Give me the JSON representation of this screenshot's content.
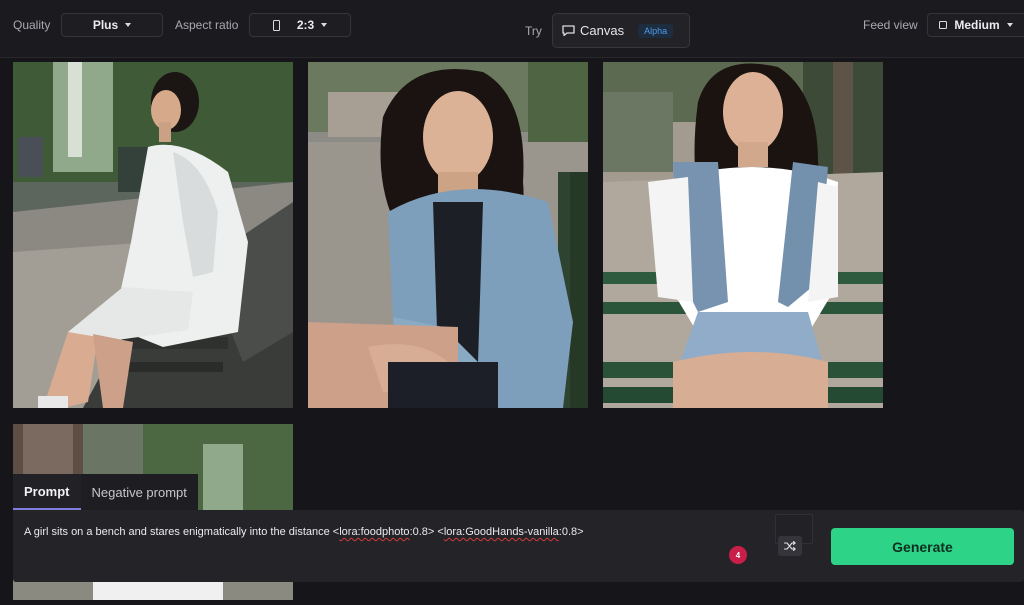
{
  "toolbar": {
    "quality_label": "Quality",
    "quality_value": "Plus",
    "aspect_label": "Aspect ratio",
    "aspect_value": "2:3",
    "try_label": "Try",
    "canvas_label": "Canvas",
    "canvas_badge": "Alpha",
    "feed_view_label": "Feed view",
    "feed_view_value": "Medium"
  },
  "icons": {
    "quality_caret": "chevron-down-icon",
    "aspect_icon": "portrait-ratio-icon",
    "canvas_icon": "chat-canvas-icon",
    "feed_icon": "square-icon",
    "shuffle": "shuffle-icon"
  },
  "images": [
    {
      "name": "generated-image-1",
      "description": "girl in white shirt sitting on bench in profile"
    },
    {
      "name": "generated-image-2",
      "description": "girl in denim jacket sitting on bench"
    },
    {
      "name": "generated-image-3",
      "description": "girl in denim vest sitting on green bench"
    },
    {
      "name": "generated-image-4",
      "description": "partially hidden image behind prompt panel"
    }
  ],
  "prompt": {
    "tab_prompt": "Prompt",
    "tab_negative": "Negative prompt",
    "text_main": "A girl sits on a bench and stares enigmatically into the distance <",
    "lora_1": "lora:foodphoto",
    "text_mid": ":0.8> <",
    "lora_2": "lora:GoodHands-vanilla",
    "text_end": ":0.8>",
    "badge_count": "4",
    "generate_label": "Generate"
  },
  "colors": {
    "accent_green": "#2dd488",
    "badge_red": "#c81e47",
    "alpha_blue": "#4d9de8",
    "tab_underline": "#7f7fe0"
  }
}
